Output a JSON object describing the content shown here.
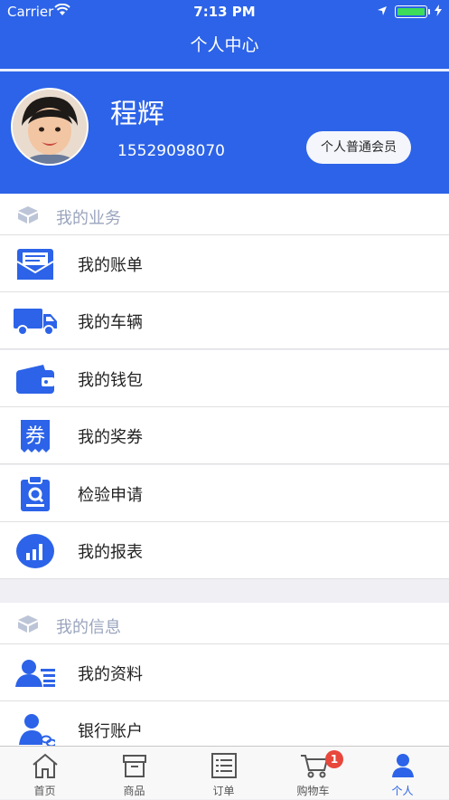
{
  "status": {
    "carrier": "Carrier",
    "time": "7:13 PM"
  },
  "nav": {
    "title": "个人中心"
  },
  "profile": {
    "name": "程辉",
    "phone": "15529098070",
    "member_label": "个人普通会员"
  },
  "business": {
    "title": "我的业务",
    "items": [
      {
        "label": "我的账单",
        "icon": "envelope-icon"
      },
      {
        "label": "我的车辆",
        "icon": "truck-icon"
      },
      {
        "label": "我的钱包",
        "icon": "wallet-icon"
      },
      {
        "label": "我的奖券",
        "icon": "coupon-icon",
        "icon_text": "券"
      },
      {
        "label": "检验申请",
        "icon": "clipboard-search-icon"
      },
      {
        "label": "我的报表",
        "icon": "chart-icon"
      }
    ]
  },
  "info": {
    "title": "我的信息",
    "items": [
      {
        "label": "我的资料",
        "icon": "profile-card-icon"
      },
      {
        "label": "银行账户",
        "icon": "user-link-icon"
      }
    ]
  },
  "tabbar": {
    "items": [
      {
        "label": "首页",
        "icon": "home-icon"
      },
      {
        "label": "商品",
        "icon": "box-icon"
      },
      {
        "label": "订单",
        "icon": "list-icon"
      },
      {
        "label": "购物车",
        "icon": "cart-icon"
      },
      {
        "label": "个人",
        "icon": "person-icon"
      }
    ],
    "cart_badge": "1",
    "active": "个人"
  },
  "colors": {
    "primary": "#2c63e8",
    "icon_blue": "#2c63e8",
    "badge": "#e8473c",
    "section_title": "#9aa4bd"
  }
}
